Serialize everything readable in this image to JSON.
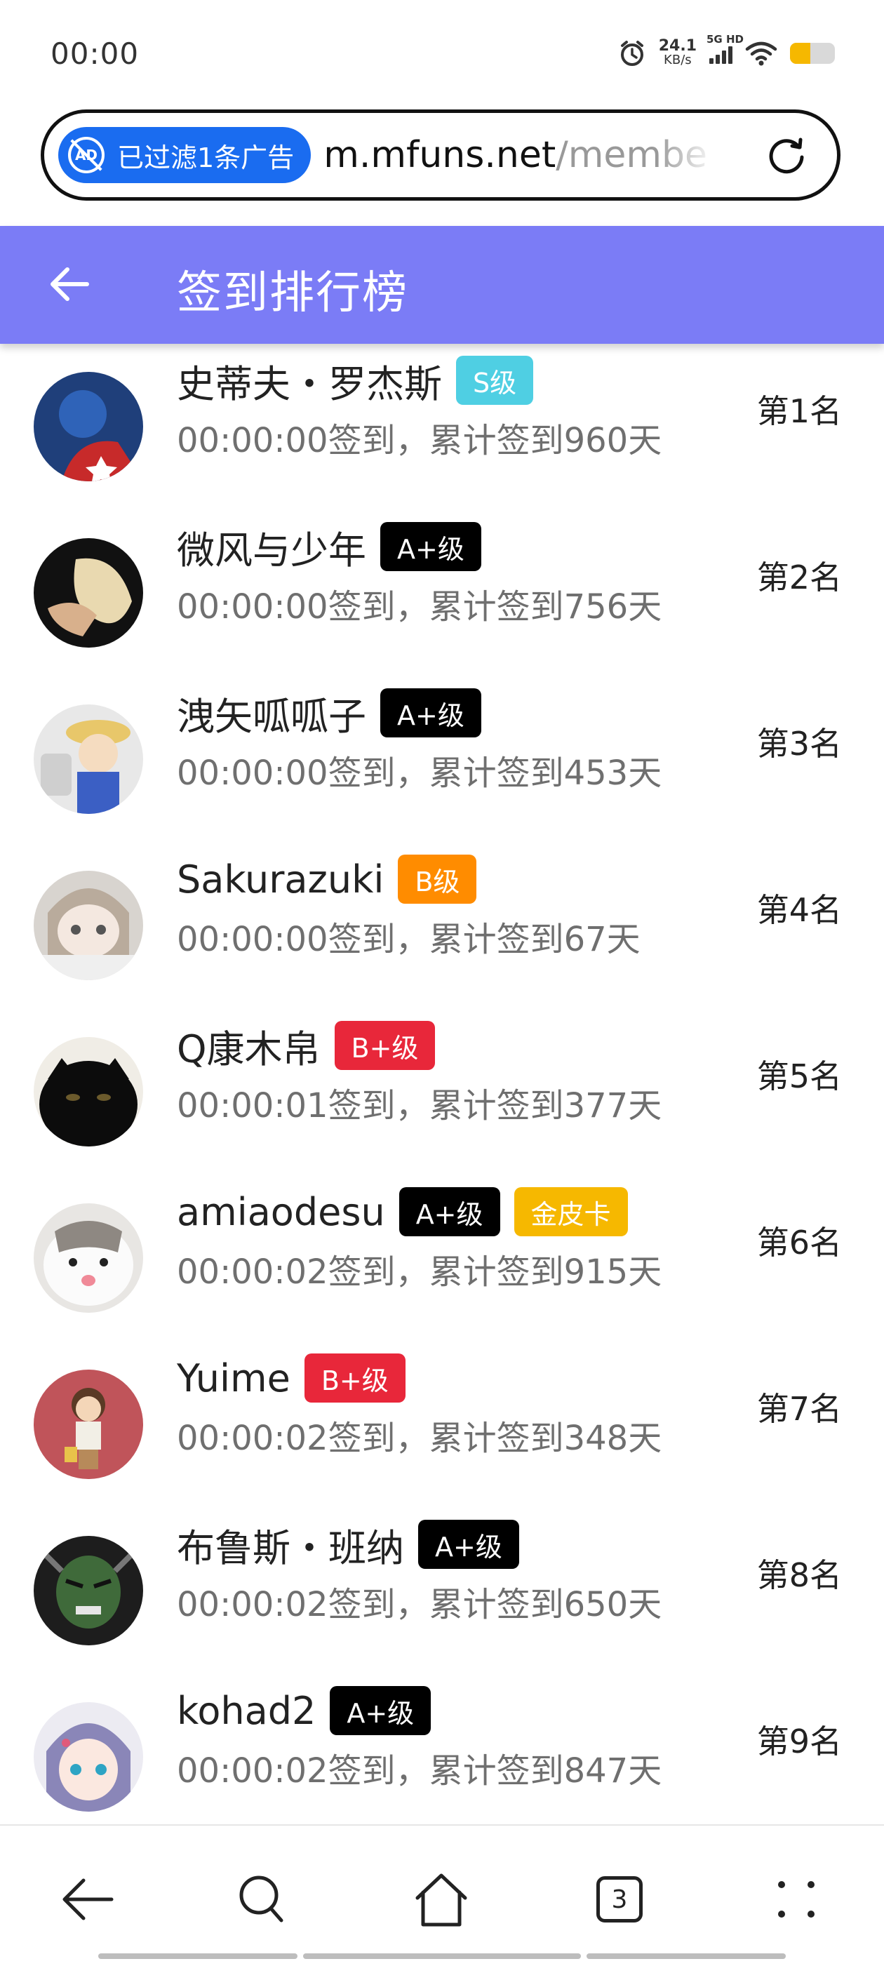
{
  "status": {
    "time": "00:00",
    "net_speed_value": "24.1",
    "net_speed_unit": "KB/s",
    "network_label": "5G HD",
    "battery_level": 0.45,
    "icons": [
      "alarm-icon",
      "signal-icon",
      "wifi-icon",
      "battery-icon"
    ]
  },
  "url_bar": {
    "ad_filter_label": "已过滤1条广告",
    "ad_icon_text": "AD",
    "host": "m.mfuns.net",
    "path": "/membe",
    "reload_icon": "reload-icon"
  },
  "header": {
    "title": "签到排行榜",
    "back_icon": "back-arrow-icon",
    "background": "#7b7cf6"
  },
  "badge_colors": {
    "S级": "#4fcfe3",
    "A+级": "#000000",
    "B级": "#ff8c00",
    "B+级": "#e8273a",
    "金皮卡": "#f6b800"
  },
  "entries": [
    {
      "name": "史蒂夫・罗杰斯",
      "badges": [
        "S级"
      ],
      "subtitle": "00:00:00签到，累计签到960天",
      "rank": "第1名",
      "avatar": "captain-avatar"
    },
    {
      "name": "微风与少年",
      "badges": [
        "A+级"
      ],
      "subtitle": "00:00:00签到，累计签到756天",
      "rank": "第2名",
      "avatar": "anime-avatar"
    },
    {
      "name": "洩矢呱呱子",
      "badges": [
        "A+级"
      ],
      "subtitle": "00:00:00签到，累计签到453天",
      "rank": "第3名",
      "avatar": "figure-avatar"
    },
    {
      "name": "Sakurazuki",
      "badges": [
        "B级"
      ],
      "subtitle": "00:00:00签到，累计签到67天",
      "rank": "第4名",
      "avatar": "anime-girl-avatar"
    },
    {
      "name": "Q康木帛",
      "badges": [
        "B+级"
      ],
      "subtitle": "00:00:01签到，累计签到377天",
      "rank": "第5名",
      "avatar": "black-cat-avatar"
    },
    {
      "name": "amiaodesu",
      "badges": [
        "A+级",
        "金皮卡"
      ],
      "subtitle": "00:00:02签到，累计签到915天",
      "rank": "第6名",
      "avatar": "white-cat-avatar"
    },
    {
      "name": "Yuime",
      "badges": [
        "B+级"
      ],
      "subtitle": "00:00:02签到，累计签到348天",
      "rank": "第7名",
      "avatar": "cartoon-girl-avatar"
    },
    {
      "name": "布鲁斯・班纳",
      "badges": [
        "A+级"
      ],
      "subtitle": "00:00:02签到，累计签到650天",
      "rank": "第8名",
      "avatar": "hulk-avatar"
    },
    {
      "name": "kohad2",
      "badges": [
        "A+级"
      ],
      "subtitle": "00:00:02签到，累计签到847天",
      "rank": "第9名",
      "avatar": "anime-blue-hair-avatar"
    }
  ],
  "bottom_nav": {
    "items": [
      "back-icon",
      "search-icon",
      "home-icon",
      "tabs-icon",
      "menu-icon"
    ],
    "tabs_count": "3"
  }
}
